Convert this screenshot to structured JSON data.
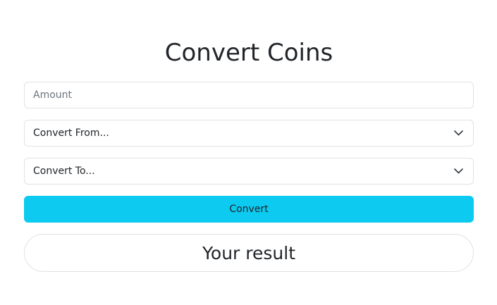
{
  "page": {
    "title": "Convert Coins"
  },
  "form": {
    "amount": {
      "placeholder": "Amount",
      "value": ""
    },
    "convert_from": {
      "selected": "Convert From..."
    },
    "convert_to": {
      "selected": "Convert To..."
    },
    "convert_button_label": "Convert"
  },
  "result": {
    "text": "Your result"
  },
  "colors": {
    "button_bg": "#0dcaf0",
    "border": "#dee2e6",
    "text": "#212529",
    "placeholder": "#6c757d"
  },
  "icons": {
    "select_indicator": "chevron-down-icon"
  }
}
